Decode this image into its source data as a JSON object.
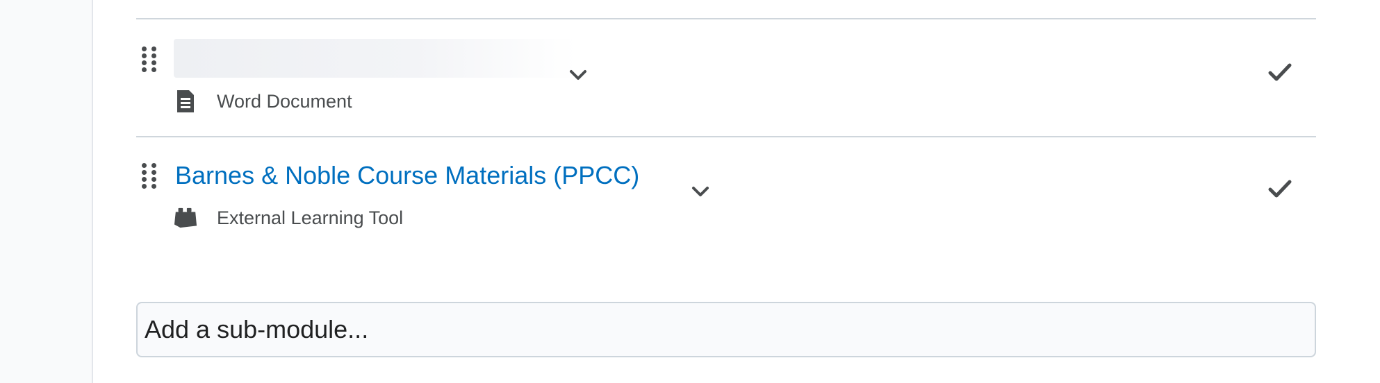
{
  "items": [
    {
      "title": "",
      "title_redacted": true,
      "type_label": "Word Document",
      "type_icon": "document-icon",
      "completed": true
    },
    {
      "title": "Barnes & Noble Course Materials (PPCC)",
      "title_redacted": false,
      "type_label": "External Learning Tool",
      "type_icon": "puzzle-piece-icon",
      "completed": true
    }
  ],
  "add_submodule": {
    "placeholder": "Add a sub-module..."
  },
  "colors": {
    "link": "#006fbf",
    "text": "#494c4e",
    "divider": "#cfd6dc",
    "rail": "#f9fafb"
  }
}
